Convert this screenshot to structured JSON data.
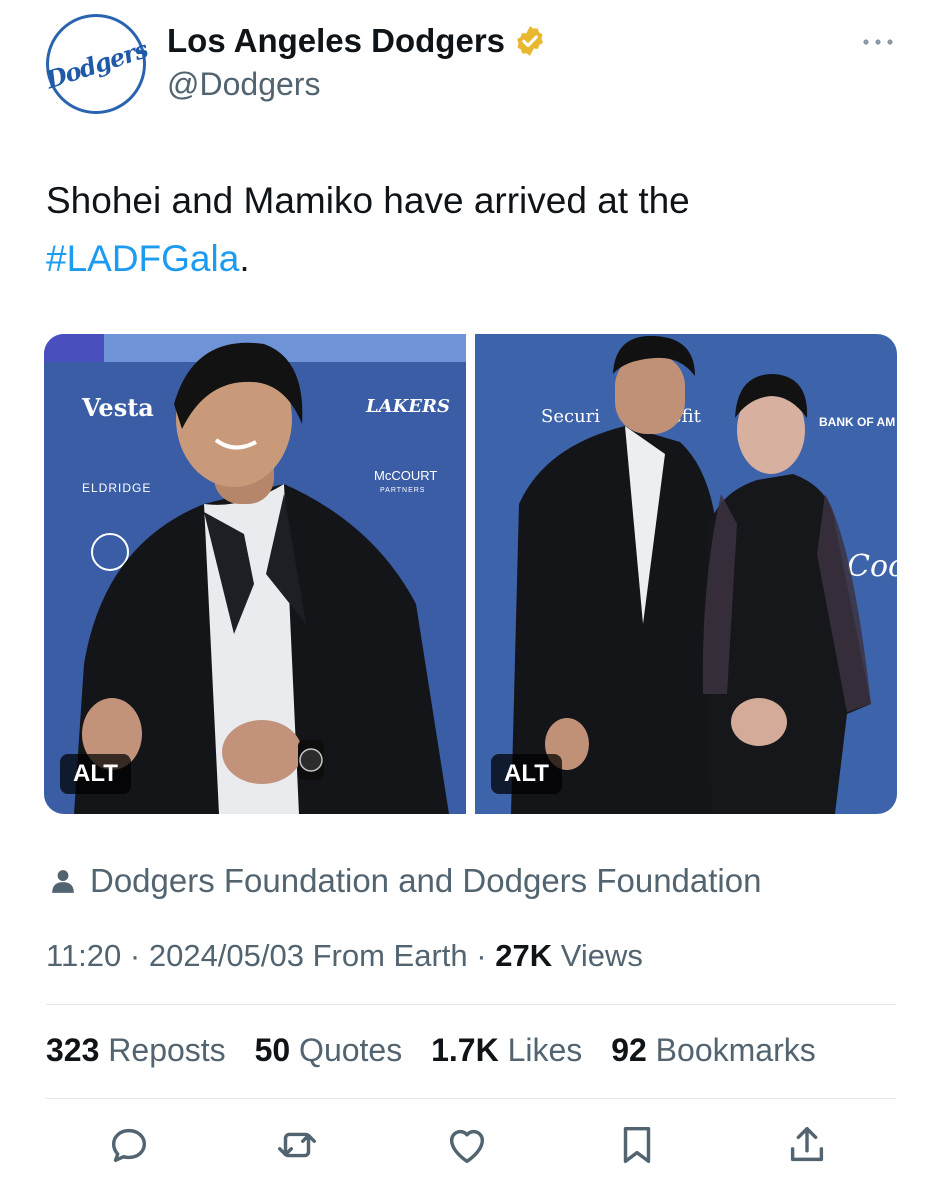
{
  "account": {
    "display_name": "Los Angeles Dodgers",
    "handle": "@Dodgers",
    "avatar_text": "Dodgers",
    "verified_color": "#e8b831"
  },
  "tweet": {
    "text_before": "Shohei and Mamiko have arrived at the",
    "hashtag": "#LADFGala",
    "text_after": "."
  },
  "media": {
    "photo_left": {
      "alt_label": "ALT",
      "backdrop_logos": [
        "Vesta",
        "ELDRIDGE",
        "LAKERS",
        "McCOURT",
        "PARTNERS"
      ]
    },
    "photo_right": {
      "alt_label": "ALT",
      "backdrop_logos": [
        "Securi",
        "efit",
        "BANK OF AM",
        "Coca"
      ]
    }
  },
  "tagged": {
    "text": "Dodgers Foundation and Dodgers Foundation"
  },
  "meta": {
    "time": "11:20",
    "date": "2024/05/03",
    "source": "From Earth",
    "views_count": "27K",
    "views_label": "Views"
  },
  "stats": {
    "reposts_count": "323",
    "reposts_label": "Reposts",
    "quotes_count": "50",
    "quotes_label": "Quotes",
    "likes_count": "1.7K",
    "likes_label": "Likes",
    "bookmarks_count": "92",
    "bookmarks_label": "Bookmarks"
  },
  "colors": {
    "link": "#1d9bf0",
    "muted": "#536471",
    "text": "#0f1419",
    "backdrop_blue": "#3a5da6"
  },
  "icons": [
    "more-icon",
    "verified-icon",
    "person-icon",
    "reply-icon",
    "repost-icon",
    "like-icon",
    "bookmark-icon",
    "share-icon"
  ]
}
